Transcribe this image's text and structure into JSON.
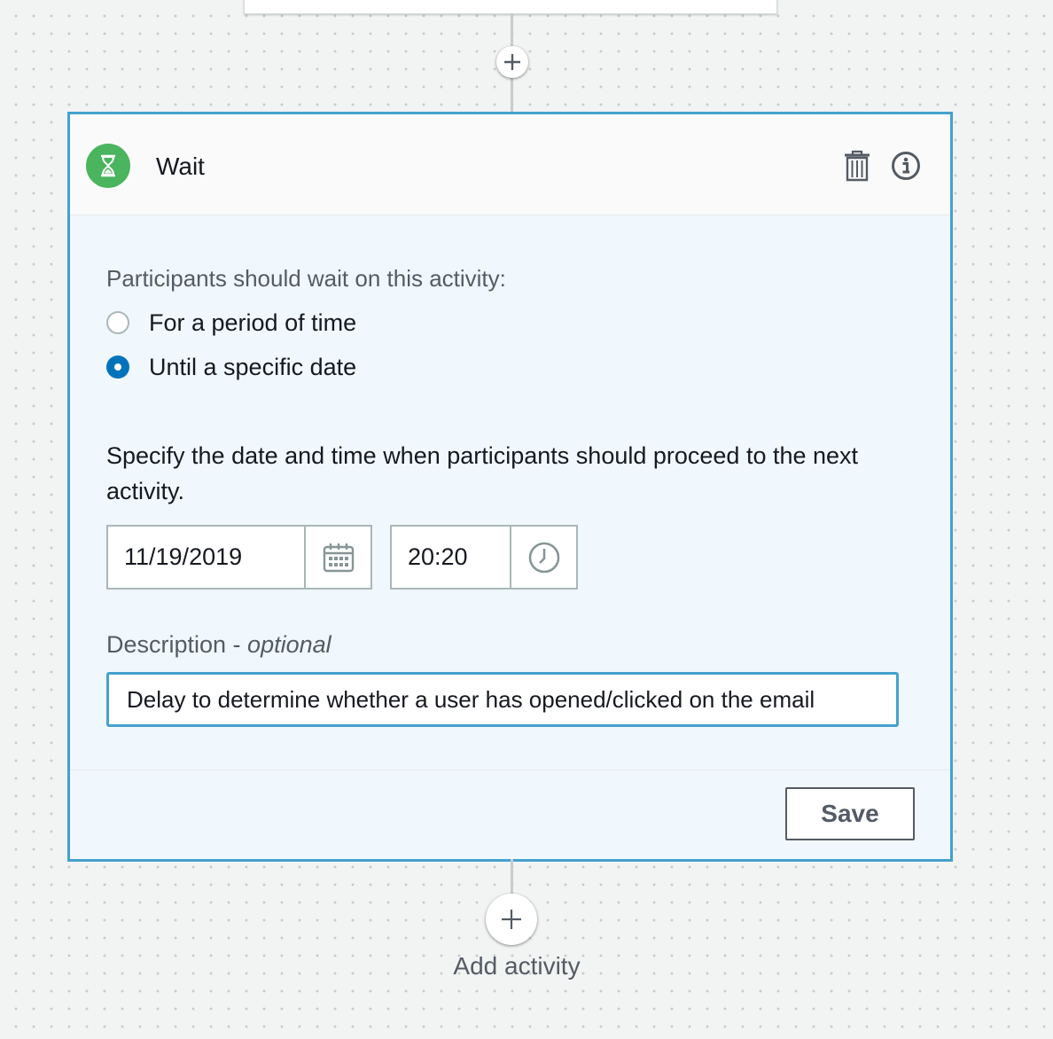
{
  "canvas": {
    "add_activity_label": "Add activity"
  },
  "wait_card": {
    "title": "Wait",
    "title_icon": "hourglass-icon",
    "actions": {
      "delete_icon": "trash-icon",
      "info_icon": "info-icon"
    },
    "wait_prompt": "Participants should wait on this activity:",
    "options": [
      {
        "label": "For a period of time",
        "selected": false
      },
      {
        "label": "Until a specific date",
        "selected": true
      }
    ],
    "instruction": "Specify the date and time when participants should proceed to the next activity.",
    "date_value": "11/19/2019",
    "date_icon": "calendar-icon",
    "time_value": "20:20",
    "time_icon": "clock-icon",
    "description_label": "Description - ",
    "description_optional": "optional",
    "description_value": "Delay to determine whether a user has opened/clicked on the email",
    "save_label": "Save"
  },
  "colors": {
    "accent_border": "#44a1cf",
    "radio_selected": "#0073bb",
    "wait_icon_bg": "#4bb45e",
    "card_body_bg": "#f1f8fd"
  }
}
